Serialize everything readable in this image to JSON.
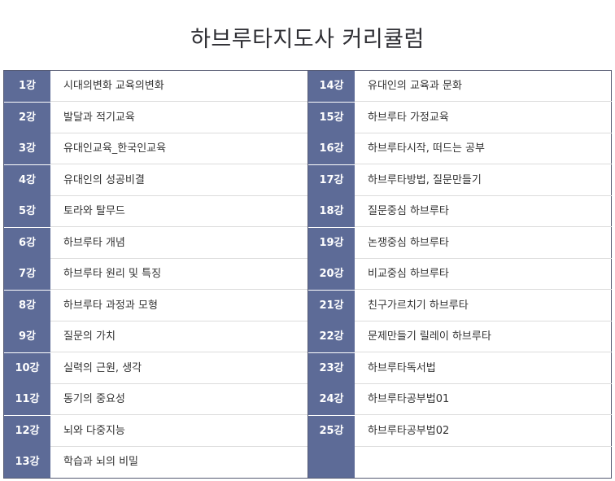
{
  "title": "하브루타지도사 커리큘럼",
  "left_column": [
    {
      "num": "1강",
      "topic": "시대의변화 교육의변화"
    },
    {
      "num": "2강",
      "topic": "발달과 적기교육"
    },
    {
      "num": "3강",
      "topic": "유대인교육_한국인교육"
    },
    {
      "num": "4강",
      "topic": "유대인의 성공비결"
    },
    {
      "num": "5강",
      "topic": "토라와 탈무드"
    },
    {
      "num": "6강",
      "topic": "하브루타 개념"
    },
    {
      "num": "7강",
      "topic": "하브루타 원리 및 특징"
    },
    {
      "num": "8강",
      "topic": "하브루타 과정과 모형"
    },
    {
      "num": "9강",
      "topic": "질문의 가치"
    },
    {
      "num": "10강",
      "topic": "실력의 근원, 생각"
    },
    {
      "num": "11강",
      "topic": "동기의 중요성"
    },
    {
      "num": "12강",
      "topic": "뇌와 다중지능"
    },
    {
      "num": "13강",
      "topic": "학습과 뇌의 비밀"
    }
  ],
  "right_column": [
    {
      "num": "14강",
      "topic": "유대인의 교육과 문화"
    },
    {
      "num": "15강",
      "topic": "하브루타 가정교육"
    },
    {
      "num": "16강",
      "topic": "하브루타시작, 떠드는 공부"
    },
    {
      "num": "17강",
      "topic": "하브루타방법, 질문만들기"
    },
    {
      "num": "18강",
      "topic": "질문중심 하브루타"
    },
    {
      "num": "19강",
      "topic": "논쟁중심 하브루타"
    },
    {
      "num": "20강",
      "topic": "비교중심 하브루타"
    },
    {
      "num": "21강",
      "topic": "친구가르치기 하브루타"
    },
    {
      "num": "22강",
      "topic": "문제만들기 릴레이 하브루타"
    },
    {
      "num": "23강",
      "topic": "하브루타독서법"
    },
    {
      "num": "24강",
      "topic": "하브루타공부법01"
    },
    {
      "num": "25강",
      "topic": "하브루타공부법02"
    }
  ],
  "colors": {
    "number_cell": "#5d6b97",
    "border": "#555a72",
    "title": "#2f2f34"
  }
}
